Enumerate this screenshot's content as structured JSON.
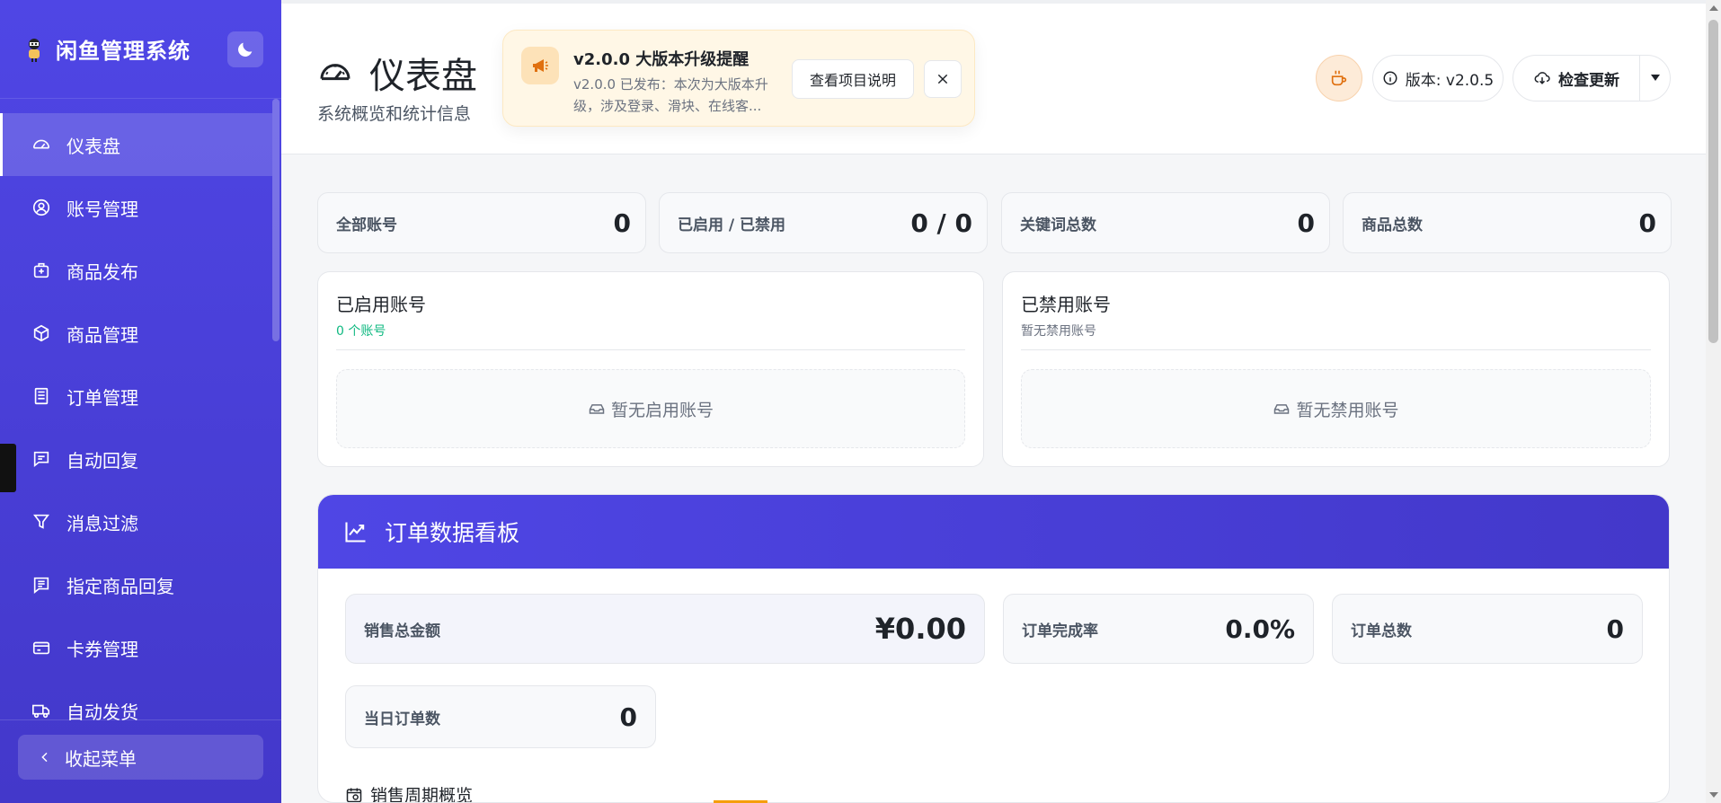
{
  "sidebar": {
    "brand": "闲鱼管理系统",
    "items": [
      {
        "label": "仪表盘",
        "icon": "dashboard-icon",
        "active": true
      },
      {
        "label": "账号管理",
        "icon": "user-circle-icon"
      },
      {
        "label": "商品发布",
        "icon": "publish-icon"
      },
      {
        "label": "商品管理",
        "icon": "box-icon"
      },
      {
        "label": "订单管理",
        "icon": "receipt-icon"
      },
      {
        "label": "自动回复",
        "icon": "chat-icon"
      },
      {
        "label": "消息过滤",
        "icon": "filter-icon"
      },
      {
        "label": "指定商品回复",
        "icon": "chat-lines-icon"
      },
      {
        "label": "卡券管理",
        "icon": "card-icon"
      },
      {
        "label": "自动发货",
        "icon": "truck-icon"
      }
    ],
    "collapse_label": "收起菜单"
  },
  "header": {
    "title": "仪表盘",
    "subtitle": "系统概览和统计信息",
    "notice": {
      "title": "v2.0.0 大版本升级提醒",
      "description": "v2.0.0 已发布：本次为大版本升级，涉及登录、滑块、在线客...",
      "button_label": "查看项目说明"
    },
    "version_label": "版本: v2.0.5",
    "update_label": "检查更新"
  },
  "stats": [
    {
      "label": "全部账号",
      "value": "0"
    },
    {
      "label": "已启用 / 已禁用",
      "value": "0 / 0"
    },
    {
      "label": "关键词总数",
      "value": "0"
    },
    {
      "label": "商品总数",
      "value": "0"
    }
  ],
  "enabled_accounts": {
    "title": "已启用账号",
    "count_text": "0 个账号",
    "empty_text": "暂无启用账号"
  },
  "disabled_accounts": {
    "title": "已禁用账号",
    "count_text": "暂无禁用账号",
    "empty_text": "暂无禁用账号"
  },
  "orders": {
    "title": "订单数据看板",
    "total_sales": {
      "label": "销售总金额",
      "value": "¥0.00"
    },
    "completion_rate": {
      "label": "订单完成率",
      "value": "0.0%"
    },
    "total_orders": {
      "label": "订单总数",
      "value": "0"
    },
    "today_orders": {
      "label": "当日订单数",
      "value": "0"
    },
    "period_label": "销售周期概览"
  },
  "colors": {
    "primary": "#4f46e5",
    "success": "#10b981",
    "notice_bg": "#fff7e6"
  }
}
